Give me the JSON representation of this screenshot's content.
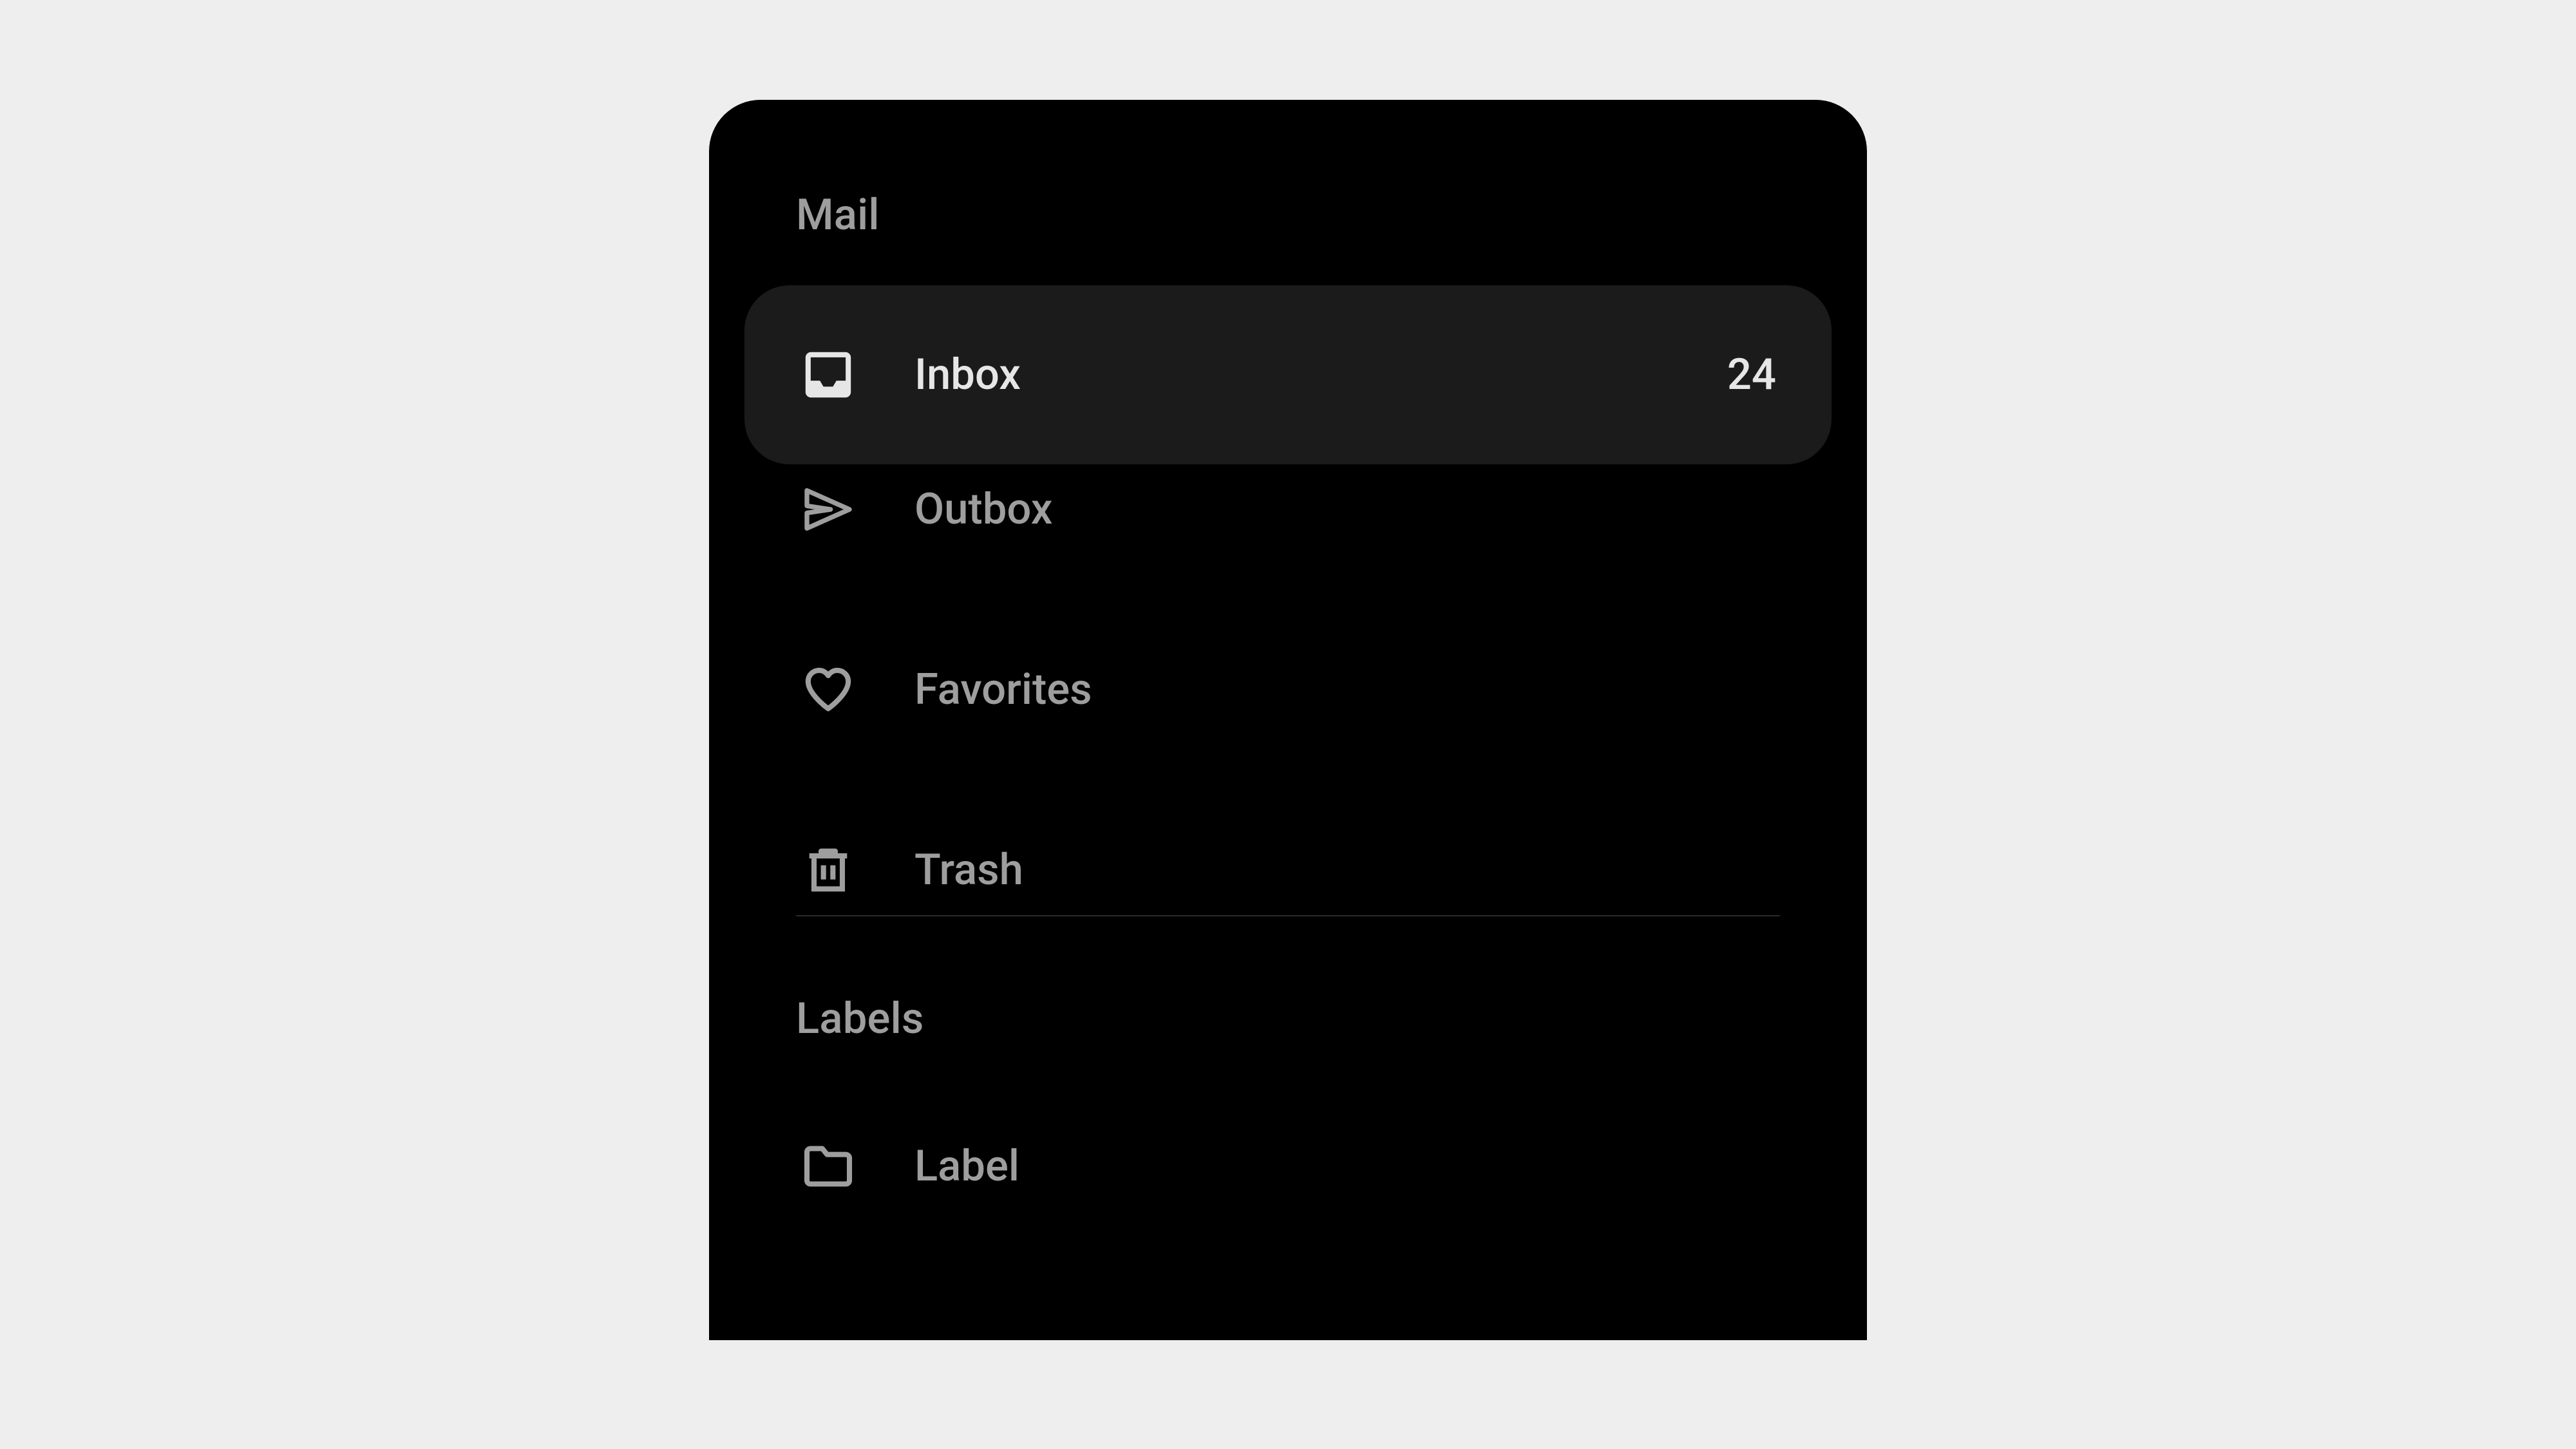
{
  "sections": {
    "mail": {
      "header": "Mail",
      "items": [
        {
          "label": "Inbox",
          "count": "24",
          "selected": true
        },
        {
          "label": "Outbox",
          "count": "",
          "selected": false
        },
        {
          "label": "Favorites",
          "count": "",
          "selected": false
        },
        {
          "label": "Trash",
          "count": "",
          "selected": false
        }
      ]
    },
    "labels": {
      "header": "Labels",
      "items": [
        {
          "label": "Label",
          "count": "",
          "selected": false
        }
      ]
    }
  }
}
